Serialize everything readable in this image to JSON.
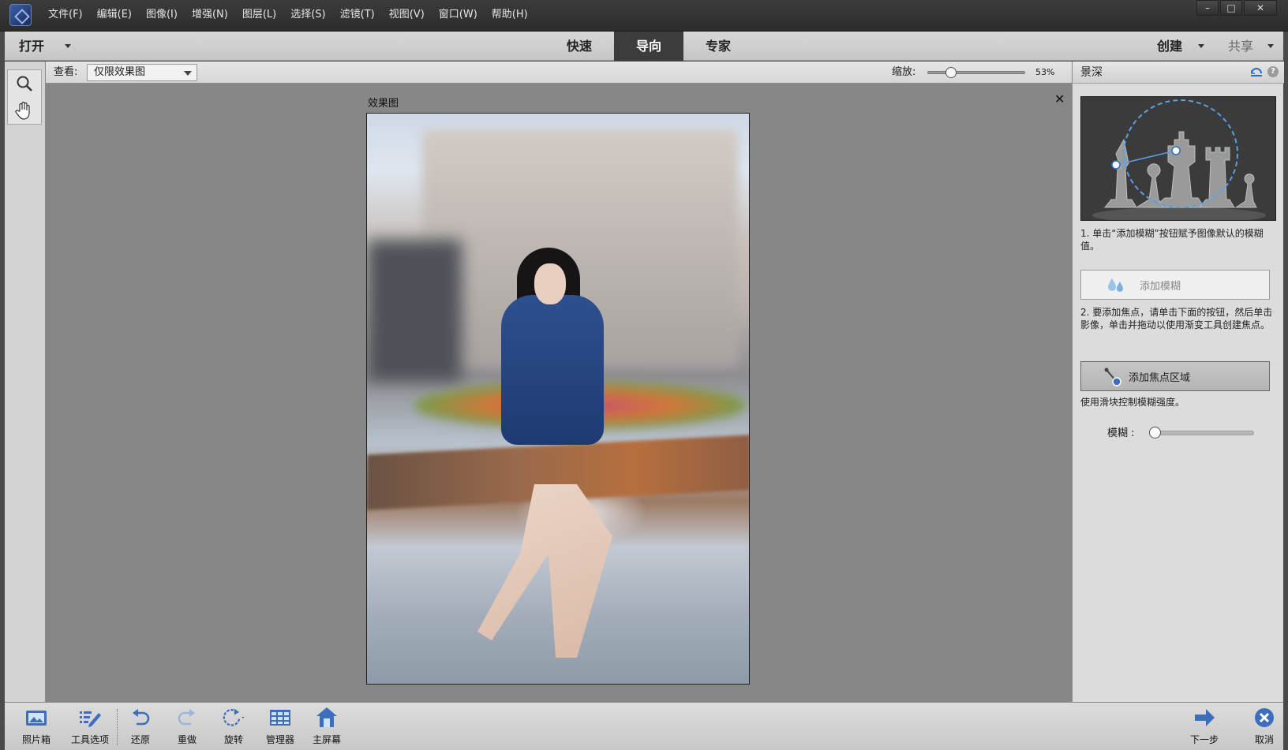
{
  "menu": [
    "文件(F)",
    "编辑(E)",
    "图像(I)",
    "增强(N)",
    "图层(L)",
    "选择(S)",
    "滤镜(T)",
    "视图(V)",
    "窗口(W)",
    "帮助(H)"
  ],
  "window_controls": {
    "minimize": "–",
    "maximize": "□",
    "close": "✕"
  },
  "modebar": {
    "open": "打开",
    "tabs": [
      {
        "label": "快速",
        "active": false
      },
      {
        "label": "导向",
        "active": true
      },
      {
        "label": "专家",
        "active": false
      }
    ],
    "create": "创建",
    "share": "共享"
  },
  "options": {
    "view_label": "查看:",
    "view_value": "仅限效果图",
    "zoom_label": "缩放:",
    "zoom_value": "53%",
    "zoom_fraction": 0.2
  },
  "canvas": {
    "title": "效果图",
    "close": "✕"
  },
  "panel": {
    "title": "景深",
    "step1": "1. 单击“添加模糊”按钮赋予图像默认的模糊值。",
    "add_blur": "添加模糊",
    "step2": "2. 要添加焦点，请单击下面的按钮，然后单击影像，单击并拖动以使用渐变工具创建焦点。",
    "add_focus": "添加焦点区域",
    "slider_hint": "使用滑块控制模糊强度。",
    "blur_label": "模糊 :",
    "blur_fraction": 0.0
  },
  "bottombar": {
    "photo_bin": "照片箱",
    "tool_options": "工具选项",
    "undo": "还原",
    "redo": "重做",
    "rotate": "旋转",
    "organizer": "管理器",
    "home": "主屏幕",
    "next": "下一步",
    "cancel": "取消"
  },
  "colors": {
    "accent": "#3c6ebc",
    "active_tab": "#3c3c3c",
    "canvas_bg": "#878787"
  }
}
